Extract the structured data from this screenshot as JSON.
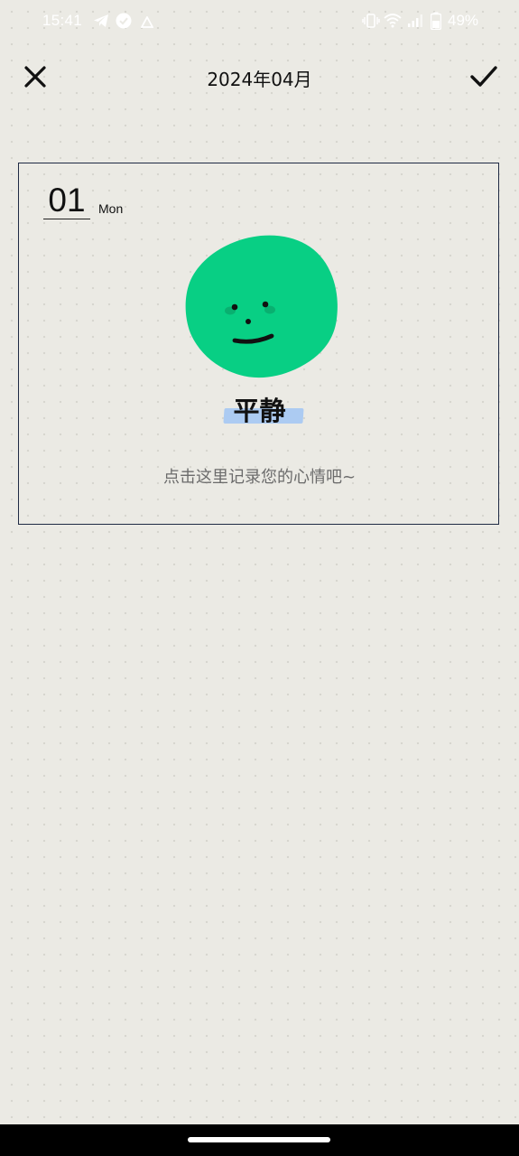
{
  "status_bar": {
    "time": "15:41",
    "battery": "49%",
    "icons": [
      "telegram-icon",
      "check-badge-icon",
      "warning-icon",
      "vibrate-icon",
      "wifi-icon",
      "signal-icon",
      "battery-icon"
    ]
  },
  "header": {
    "title": "2024年04月",
    "close_icon": "close-icon",
    "confirm_icon": "checkmark-icon"
  },
  "entry": {
    "day": "01",
    "weekday": "Mon",
    "mood": "平静",
    "mood_icon": "calm-face-icon",
    "prompt": "点击这里记录您的心情吧~"
  },
  "colors": {
    "background": "#ebeae4",
    "face_green": "#08cf84",
    "highlight_blue": "#a9c9f2",
    "card_border": "#1f2a44"
  }
}
